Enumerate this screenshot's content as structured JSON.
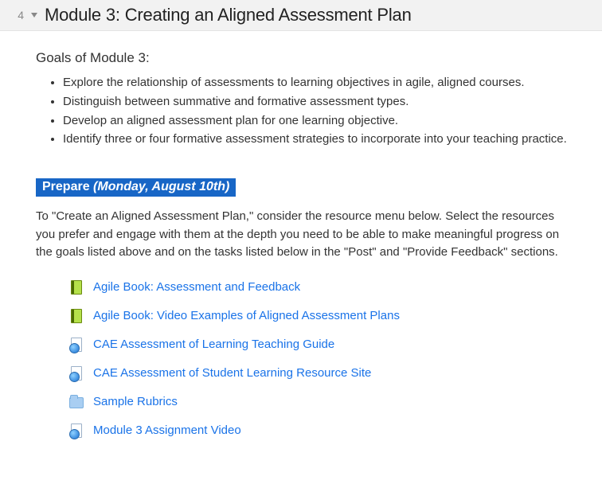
{
  "header": {
    "number": "4",
    "title": "Module 3: Creating an Aligned Assessment Plan"
  },
  "goals": {
    "heading": "Goals of Module 3:",
    "items": [
      "Explore the relationship of assessments to learning objectives in agile, aligned courses.",
      "Distinguish between summative and formative assessment types.",
      "Develop an aligned assessment plan for one learning objective.",
      "Identify three or four formative assessment strategies to incorporate into your teaching practice."
    ]
  },
  "prepare": {
    "word": "Prepare",
    "date": " (Monday, August 10th)",
    "description": "To \"Create an Aligned Assessment Plan,\" consider the resource menu below.  Select the resources you prefer and engage with them at the depth you need to be able to make meaningful progress on the goals listed above and on the tasks listed below in the \"Post\" and \"Provide Feedback\" sections."
  },
  "resources": [
    {
      "label": "Agile Book: Assessment and Feedback",
      "icon": "book"
    },
    {
      "label": "Agile Book: Video Examples of Aligned Assessment Plans",
      "icon": "book"
    },
    {
      "label": "CAE Assessment of Learning Teaching Guide",
      "icon": "webdoc"
    },
    {
      "label": "CAE Assessment of Student Learning Resource Site",
      "icon": "webdoc"
    },
    {
      "label": "Sample Rubrics",
      "icon": "folder"
    },
    {
      "label": "Module 3 Assignment Video",
      "icon": "webdoc"
    }
  ]
}
